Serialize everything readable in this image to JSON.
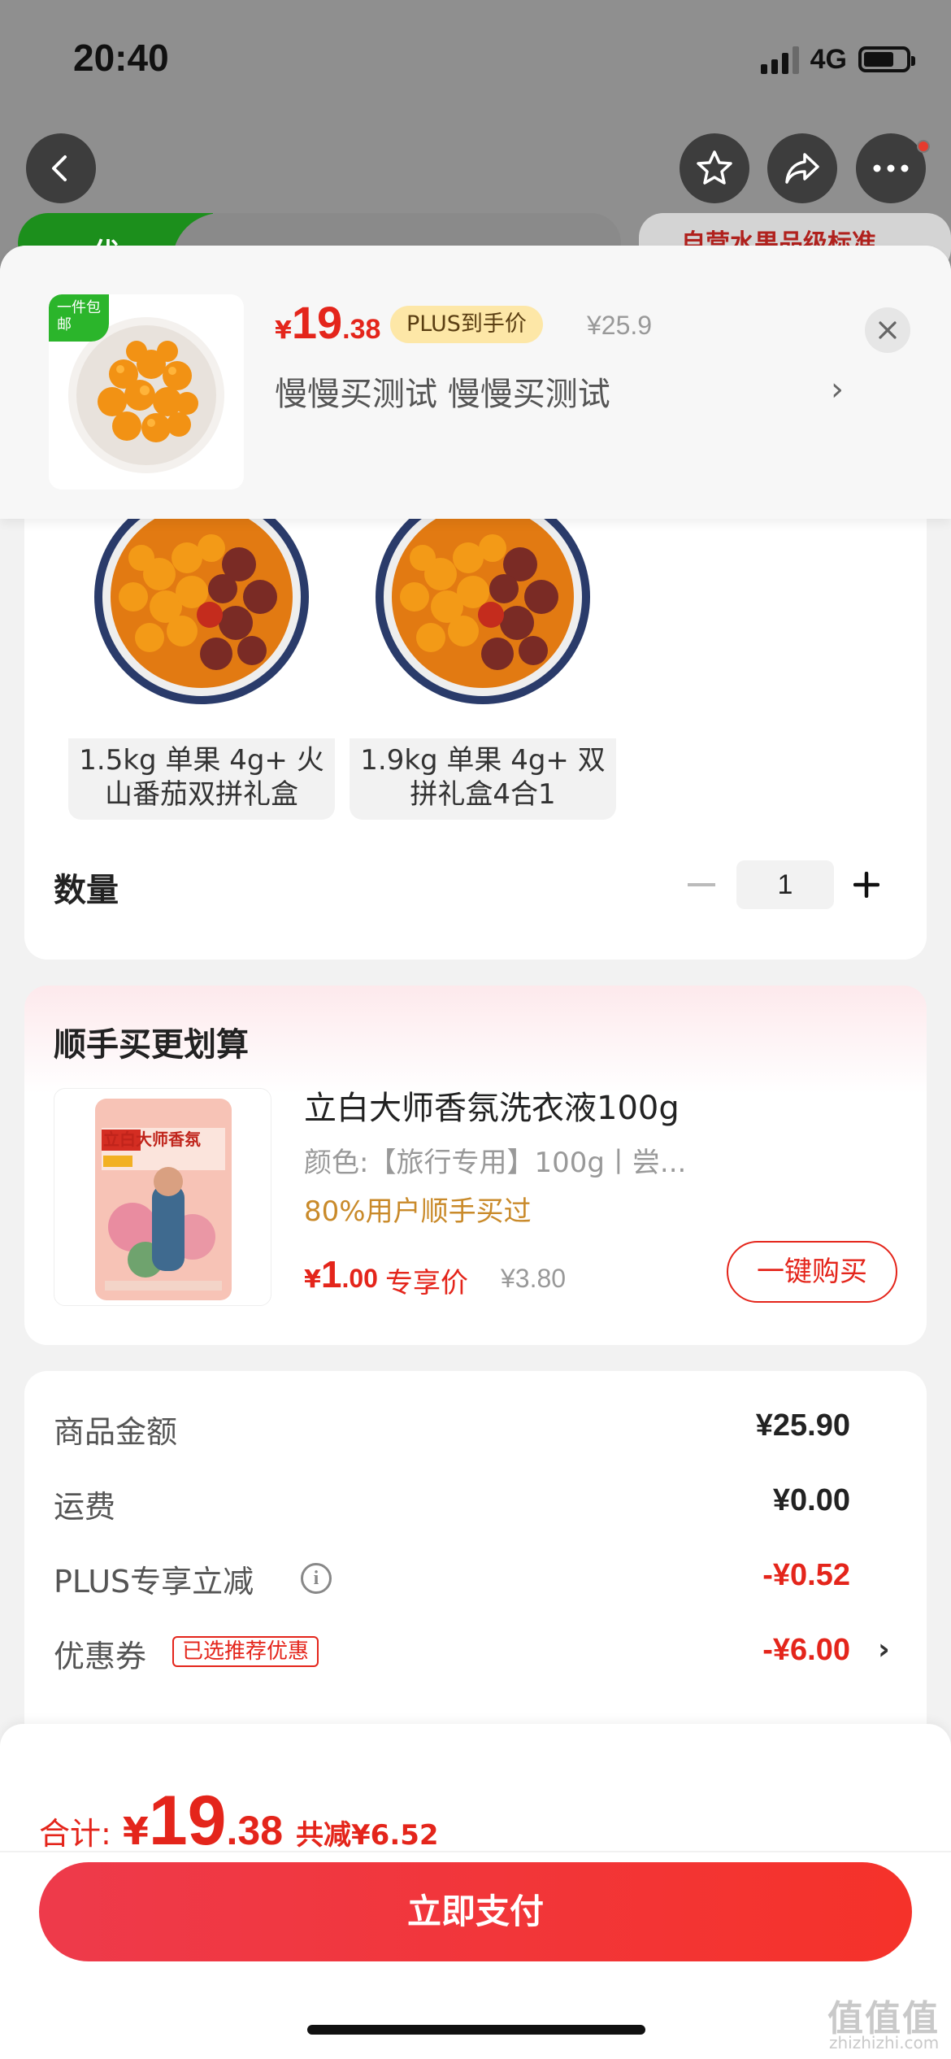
{
  "status_bar": {
    "time": "20:40",
    "network": "4G"
  },
  "background_page": {
    "tab_left": "优",
    "tab_right": "自营水果品级标准"
  },
  "product": {
    "badge": "一件包邮",
    "price_symbol": "¥",
    "price_int": "19",
    "price_dec": ".38",
    "plus_tag": "PLUS到手价",
    "original_price": "¥25.9",
    "variant": "慢慢买测试  慢慢买测试"
  },
  "sku_options": [
    {
      "label": "1.5kg 单果 4g+ 火山番茄双拼礼盒"
    },
    {
      "label": "1.9kg 单果 4g+ 双拼礼盒4合1"
    }
  ],
  "quantity": {
    "label": "数量",
    "value": "1"
  },
  "addon": {
    "title": "顺手买更划算",
    "name": "立白大师香氛洗衣液100g",
    "attr": "颜色:【旅行专用】100g丨尝...",
    "popularity": "80%用户顺手买过",
    "price_symbol": "¥",
    "price_int": "1",
    "price_dec": ".00",
    "price_tag": "专享价",
    "original_price": "¥3.80",
    "buy_label": "一键购买",
    "package_text": "立白大师香氛"
  },
  "summary": {
    "goods_label": "商品金额",
    "goods_value": "¥25.90",
    "shipping_label": "运费",
    "shipping_value": "¥0.00",
    "plus_label": "PLUS专享立减",
    "plus_value": "-¥0.52",
    "coupon_label": "优惠券",
    "coupon_tag": "已选推荐优惠",
    "coupon_value": "-¥6.00"
  },
  "checkout": {
    "total_label": "合计:",
    "total_symbol": "¥",
    "total_int": "19",
    "total_dec": ".38",
    "saved": "共减¥6.52",
    "pay_label": "立即支付"
  },
  "watermark": {
    "text": "值值值",
    "url": "zhizhizhi.com"
  },
  "colors": {
    "accent": "#e4251b",
    "plus_tag_bg": "#fde7a7",
    "badge_green": "#2bb52b"
  }
}
